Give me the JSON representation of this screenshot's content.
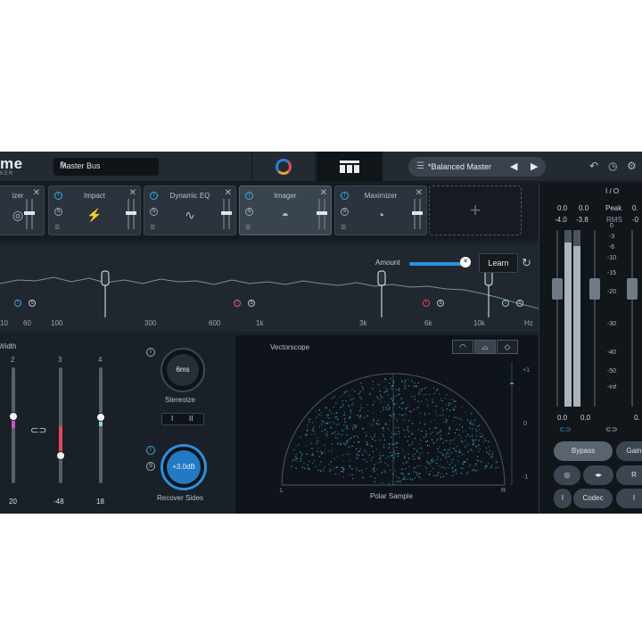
{
  "header": {
    "logo_text": "me",
    "logo_sub": "KER",
    "bus_name": "Master Bus",
    "preset_name": "*Balanced Master"
  },
  "modules": [
    {
      "name": "izer",
      "glyph": "◎"
    },
    {
      "name": "Impact",
      "glyph": "⚡"
    },
    {
      "name": "Dynamic EQ",
      "glyph": "∿"
    },
    {
      "name": "Imager",
      "glyph": "◓"
    },
    {
      "name": "Maximizer",
      "glyph": "◔"
    }
  ],
  "add_module": "+",
  "spectrum": {
    "amount_label": "Amount",
    "learn_label": "Learn",
    "amount_value": 0.95,
    "freq_labels": [
      "10",
      "60",
      "100",
      "300",
      "600",
      "1k",
      "3k",
      "6k",
      "10k",
      "Hz"
    ]
  },
  "width": {
    "title": "Width",
    "bands": [
      {
        "num": "2",
        "value": "20",
        "fill_color": "#c257c9"
      },
      {
        "num": "3",
        "value": "-48",
        "fill_color": "#e14a54"
      },
      {
        "num": "4",
        "value": "18",
        "fill_color": "#8fd2c9"
      }
    ],
    "stereoize_value": "6ms",
    "stereoize_label": "Stereoize",
    "toggle_a": "I",
    "toggle_b": "II",
    "recover_value": "+3.0dB",
    "recover_label": "Recover Sides"
  },
  "vectorscope": {
    "title": "Vectorscope",
    "scale": [
      "+1",
      "0",
      "-1"
    ],
    "left_label": "L",
    "right_label": "R",
    "mode_label": "Polar Sample"
  },
  "meters": {
    "io_label": "I / O",
    "peak_label": "Peak",
    "rms_label": "RMS",
    "left_peak": "0.0",
    "right_peak": "0.0",
    "left_rms": "-4.0",
    "right_rms": "-3.8",
    "right_col_peak": "0.",
    "right_col_rms": "-0",
    "scale": [
      "0",
      "-3",
      "-6",
      "-10",
      "-15",
      "-20",
      "-30",
      "-40",
      "-50",
      "-Inf"
    ],
    "bottom_left": "0.0",
    "bottom_right": "0.0",
    "bottom_far": "0.",
    "bypass_label": "Bypass",
    "gain_label": "Gain",
    "codec_label": "Codec",
    "r_label": "R"
  },
  "colors": {
    "accent": "#2b8fe0",
    "scope_dots": "#3fb6e8"
  }
}
